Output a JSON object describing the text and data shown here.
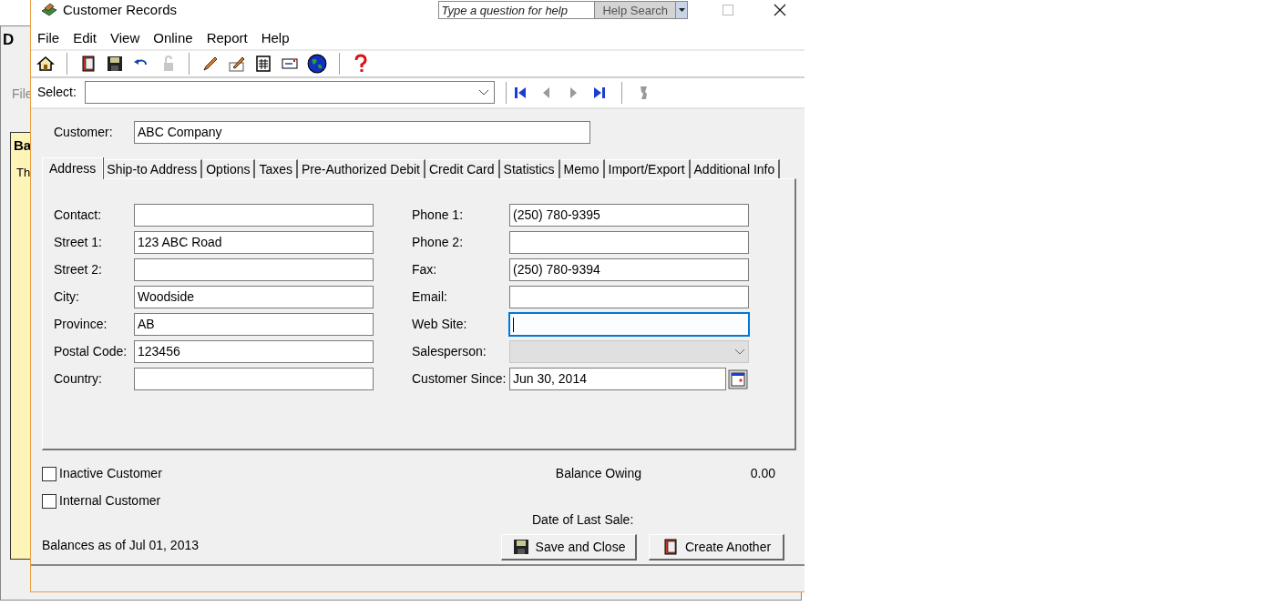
{
  "background_window": {
    "title": "D",
    "menu": "File",
    "panel_heading": "Ba",
    "panel_text": "Th"
  },
  "window": {
    "title": "Customer Records",
    "help_field": {
      "placeholder": "Type a question for help"
    },
    "help_button": "Help Search"
  },
  "menu": [
    "File",
    "Edit",
    "View",
    "Online",
    "Report",
    "Help"
  ],
  "toolbar": [
    {
      "kind": "home"
    },
    {
      "kind": "sep"
    },
    {
      "kind": "book"
    },
    {
      "kind": "save"
    },
    {
      "kind": "undo"
    },
    {
      "kind": "lock"
    },
    {
      "kind": "sep"
    },
    {
      "kind": "pencil"
    },
    {
      "kind": "edit"
    },
    {
      "kind": "calc"
    },
    {
      "kind": "mail"
    },
    {
      "kind": "globe"
    },
    {
      "kind": "sep"
    },
    {
      "kind": "help"
    }
  ],
  "select": {
    "label": "Select:",
    "nav": [
      {
        "kind": "first",
        "disabled": false
      },
      {
        "kind": "prev",
        "disabled": true
      },
      {
        "kind": "next",
        "disabled": true
      },
      {
        "kind": "last",
        "disabled": false
      },
      {
        "kind": "sep"
      },
      {
        "kind": "remove",
        "disabled": true
      }
    ]
  },
  "customer": {
    "label": "Customer:",
    "value": "ABC Company"
  },
  "tabs": [
    {
      "label": "Address",
      "selected": true
    },
    {
      "label": "Ship-to Address",
      "selected": false
    },
    {
      "label": "Options",
      "selected": false
    },
    {
      "label": "Taxes",
      "selected": false
    },
    {
      "label": "Pre-Authorized Debit",
      "selected": false
    },
    {
      "label": "Credit Card",
      "selected": false
    },
    {
      "label": "Statistics",
      "selected": false
    },
    {
      "label": "Memo",
      "selected": false
    },
    {
      "label": "Import/Export",
      "selected": false
    },
    {
      "label": "Additional Info",
      "selected": false
    }
  ],
  "left_fields": [
    {
      "label": "Contact:"
    },
    {
      "label": "Street 1:",
      "value": "123 ABC Road"
    },
    {
      "label": "Street 2:"
    },
    {
      "label": "City:",
      "value": "Woodside"
    },
    {
      "label": "Province:",
      "value": "AB"
    },
    {
      "label": "Postal Code:",
      "value": "123456"
    },
    {
      "label": "Country:"
    }
  ],
  "right_fields": [
    {
      "label": "Phone 1:",
      "value": "(250) 780-9395",
      "kind": "text",
      "focused": false
    },
    {
      "label": "Phone 2:",
      "kind": "text",
      "focused": false
    },
    {
      "label": "Fax:",
      "value": "(250) 780-9394",
      "kind": "text",
      "focused": false
    },
    {
      "label": "Email:",
      "kind": "text",
      "focused": false
    },
    {
      "label": "Web Site:",
      "kind": "text",
      "focused": true
    },
    {
      "label": "Salesperson:",
      "kind": "dropdown"
    },
    {
      "label": "Customer Since:",
      "value": "Jun 30, 2014",
      "kind": "date"
    }
  ],
  "checkboxes": [
    {
      "label": "Inactive Customer",
      "checked": false
    },
    {
      "label": "Internal Customer",
      "checked": false
    }
  ],
  "balance_owing": {
    "label": "Balance Owing",
    "value": "0.00"
  },
  "date_of_last_sale": "Date of Last Sale:",
  "balances_as_of": "Balances as of Jul 01, 2013",
  "buttons": [
    {
      "label": "Save and Close",
      "kind": "save"
    },
    {
      "label": "Create Another",
      "kind": "book"
    }
  ]
}
